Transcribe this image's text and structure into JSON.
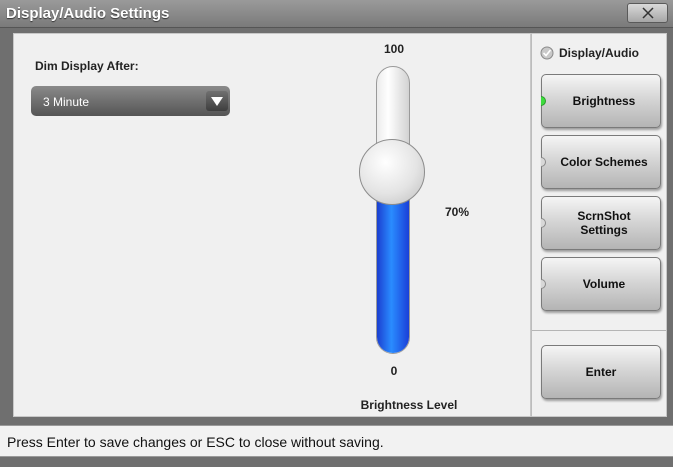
{
  "window": {
    "title": "Display/Audio Settings",
    "close_label": "X"
  },
  "dim_display": {
    "label": "Dim Display After:",
    "selected": "3 Minute"
  },
  "brightness_slider": {
    "max_label": "100",
    "min_label": "0",
    "value": 70,
    "value_label": "70%",
    "caption": "Brightness Level"
  },
  "side_menu": {
    "header": "Display/Audio",
    "buttons": [
      {
        "label": "Brightness",
        "active": true
      },
      {
        "label": "Color Schemes",
        "active": false
      },
      {
        "label": "ScrnShot Settings",
        "active": false
      },
      {
        "label": "Volume",
        "active": false
      }
    ],
    "enter_label": "Enter"
  },
  "status_bar": {
    "text": "Press Enter to save changes or ESC to close without saving."
  },
  "colors": {
    "accent_fill": "#2a8cff",
    "led_active": "#3ddc3d",
    "titlebar": "#8a8a8a"
  }
}
